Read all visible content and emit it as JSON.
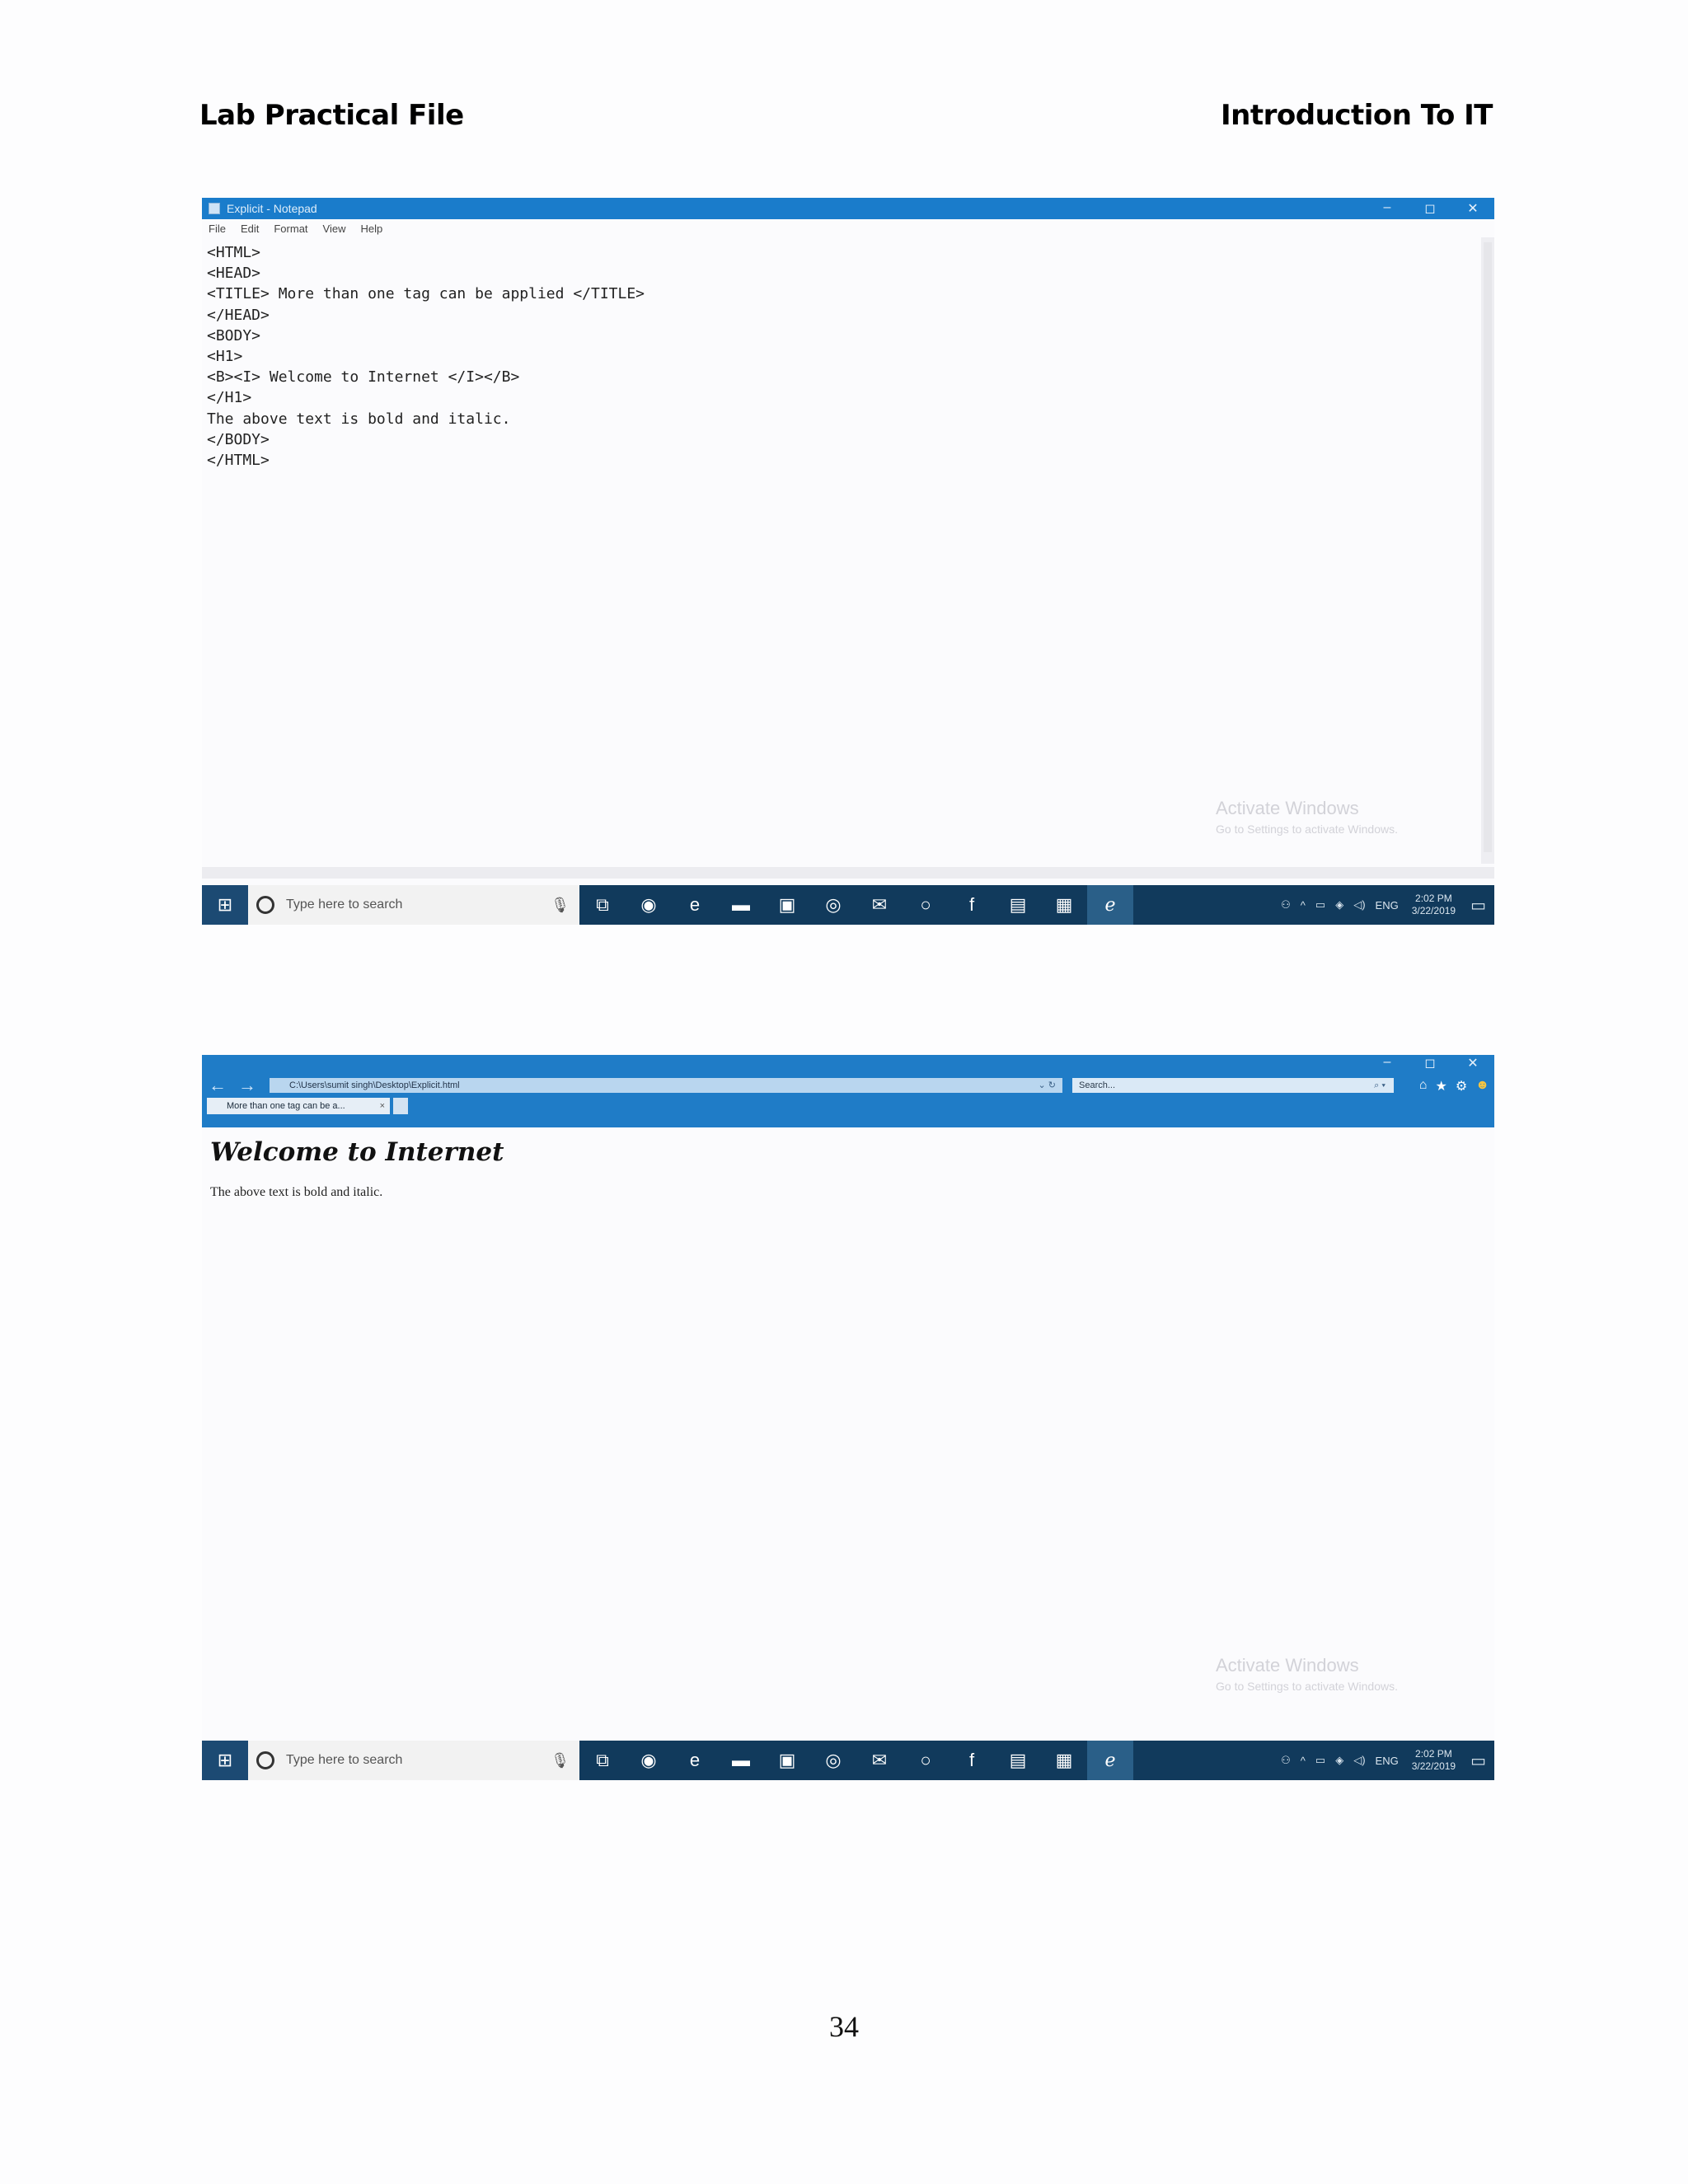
{
  "header": {
    "left": "Lab Practical File",
    "right": "Introduction To IT"
  },
  "notepad": {
    "title": "Explicit - Notepad",
    "window_controls": [
      "–",
      "◻",
      "✕"
    ],
    "menu": [
      "File",
      "Edit",
      "Format",
      "View",
      "Help"
    ],
    "code": "<HTML>\n<HEAD>\n<TITLE> More than one tag can be applied </TITLE>\n</HEAD>\n<BODY>\n<H1>\n<B><I> Welcome to Internet </I></B>\n</H1>\nThe above text is bold and italic.\n</BODY>\n</HTML>"
  },
  "watermark": {
    "line1": "Activate Windows",
    "line2": "Go to Settings to activate Windows."
  },
  "taskbar": {
    "search_placeholder": "Type here to search",
    "lang": "ENG",
    "time": "2:02 PM",
    "date": "3/22/2019"
  },
  "browser": {
    "address": "C:\\Users\\sumit singh\\Desktop\\Explicit.html",
    "search_placeholder": "Search...",
    "tab_title": "More than one tag can be a...",
    "tab_close": "×",
    "window_controls": [
      "–",
      "◻",
      "✕"
    ],
    "heading": "Welcome to Internet",
    "paragraph": "The above text is bold and italic."
  },
  "page_number": "34"
}
